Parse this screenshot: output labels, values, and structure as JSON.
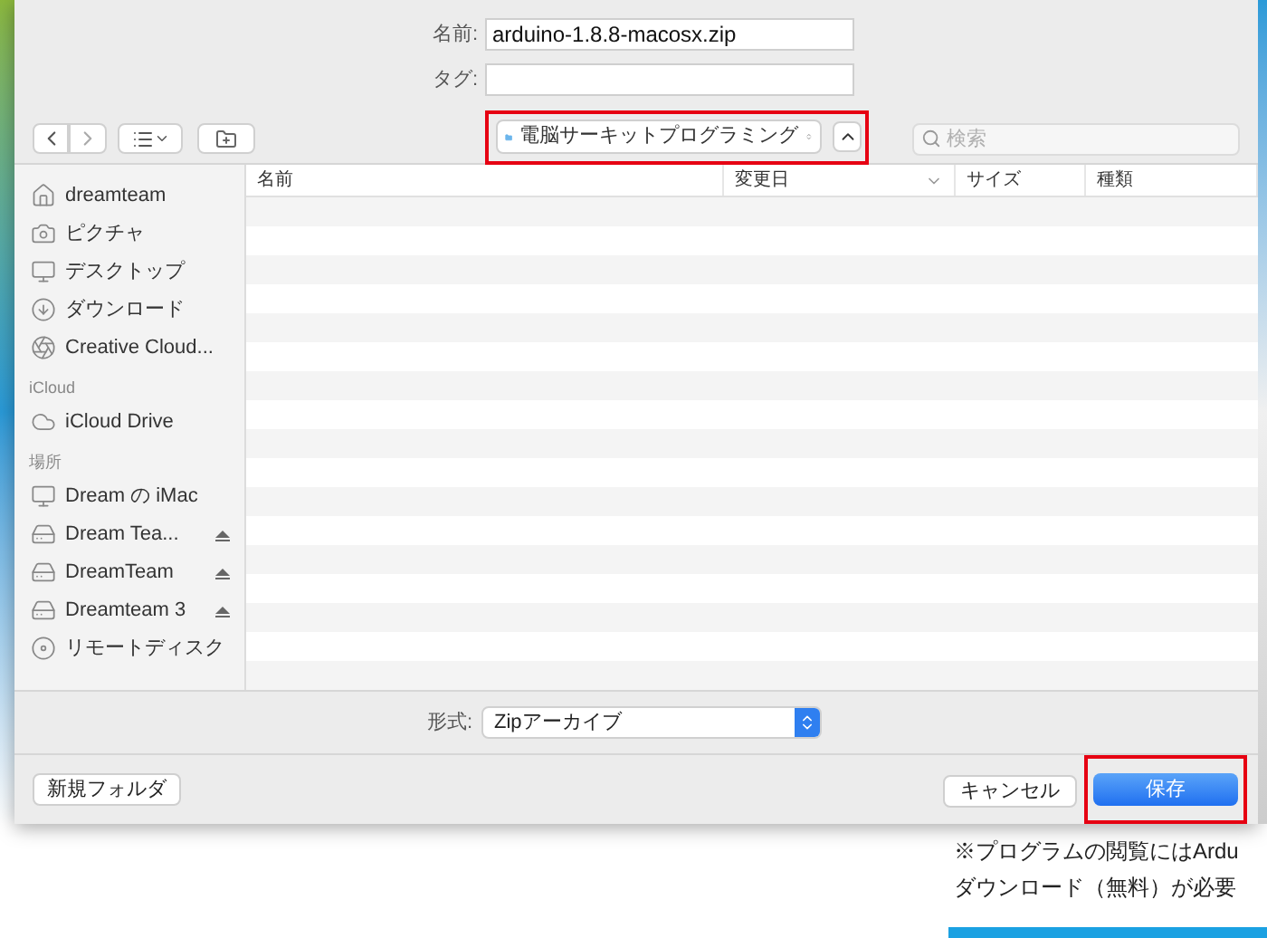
{
  "dialog": {
    "name_label": "名前:",
    "name_value": "arduino-1.8.8-macosx.zip",
    "tag_label": "タグ:",
    "path": "電脳サーキットプログラミング",
    "search_placeholder": "検索",
    "sidebar": [
      {
        "items": [
          {
            "label": "dreamteam",
            "ejectable": false
          },
          {
            "label": "ピクチャ",
            "ejectable": false
          },
          {
            "label": "デスクトップ",
            "ejectable": false
          },
          {
            "label": "ダウンロード",
            "ejectable": false
          },
          {
            "label": "Creative Cloud...",
            "ejectable": false
          }
        ]
      },
      {
        "heading": "iCloud",
        "items": [
          {
            "label": "iCloud Drive",
            "ejectable": false
          }
        ]
      },
      {
        "heading": "場所",
        "items": [
          {
            "label": "Dream の iMac",
            "ejectable": false
          },
          {
            "label": "Dream Tea...",
            "ejectable": true
          },
          {
            "label": "DreamTeam",
            "ejectable": true
          },
          {
            "label": "Dreamteam 3",
            "ejectable": true
          },
          {
            "label": "リモートディスク",
            "ejectable": false
          }
        ]
      }
    ],
    "columns": [
      {
        "label": "名前",
        "sorted": false
      },
      {
        "label": "変更日",
        "sorted": true
      },
      {
        "label": "サイズ",
        "sorted": false
      },
      {
        "label": "種類",
        "sorted": false
      }
    ],
    "format_label": "形式:",
    "format_value": "Zipアーカイブ",
    "buttons": [
      {
        "label": "新規フォルダ",
        "default": false
      },
      {
        "label": "キャンセル",
        "default": false
      },
      {
        "label": "保存",
        "default": true
      }
    ]
  },
  "page_text": [
    "※プログラムの閲覧にはArdu",
    "ダウンロード（無料）が必要"
  ]
}
